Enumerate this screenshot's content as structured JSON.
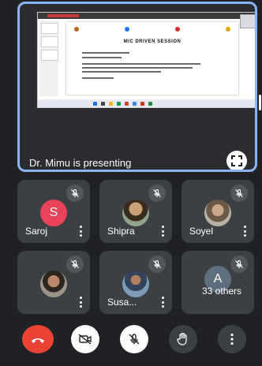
{
  "presentation": {
    "presenting_text": "Dr. Mimu is presenting",
    "slide": {
      "title": "MIC DRIVEN SESSION",
      "logos": [
        "Ministry of Education",
        "MIC",
        "IIC",
        "Seal"
      ]
    }
  },
  "participants": [
    {
      "name": "Saroj",
      "initial": "S",
      "avatar_type": "initial",
      "avatar_color": "#e8435a"
    },
    {
      "name": "Shipra",
      "initial": "",
      "avatar_type": "photo",
      "avatar_color": "#7a6a52"
    },
    {
      "name": "Soyel",
      "initial": "",
      "avatar_type": "photo",
      "avatar_color": "#8b7f6a"
    },
    {
      "name": "",
      "initial": "",
      "avatar_type": "photo",
      "avatar_color": "#6f5d4a"
    },
    {
      "name": "Susa...",
      "initial": "",
      "avatar_type": "photo",
      "avatar_color": "#5d6f7a"
    }
  ],
  "others_tile": {
    "initial": "A",
    "avatar_color": "#5f6f7e",
    "label": "33 others"
  },
  "controls": {
    "end_call_color": "#ea4335",
    "camera_state": "off",
    "mic_state": "off",
    "icons": [
      "end-call-icon",
      "camera-off-icon",
      "mic-off-icon",
      "raise-hand-icon",
      "more-options-icon"
    ]
  },
  "colors": {
    "background": "#202124",
    "tile": "#3c4043",
    "presenter_border": "#8ab4f8"
  }
}
